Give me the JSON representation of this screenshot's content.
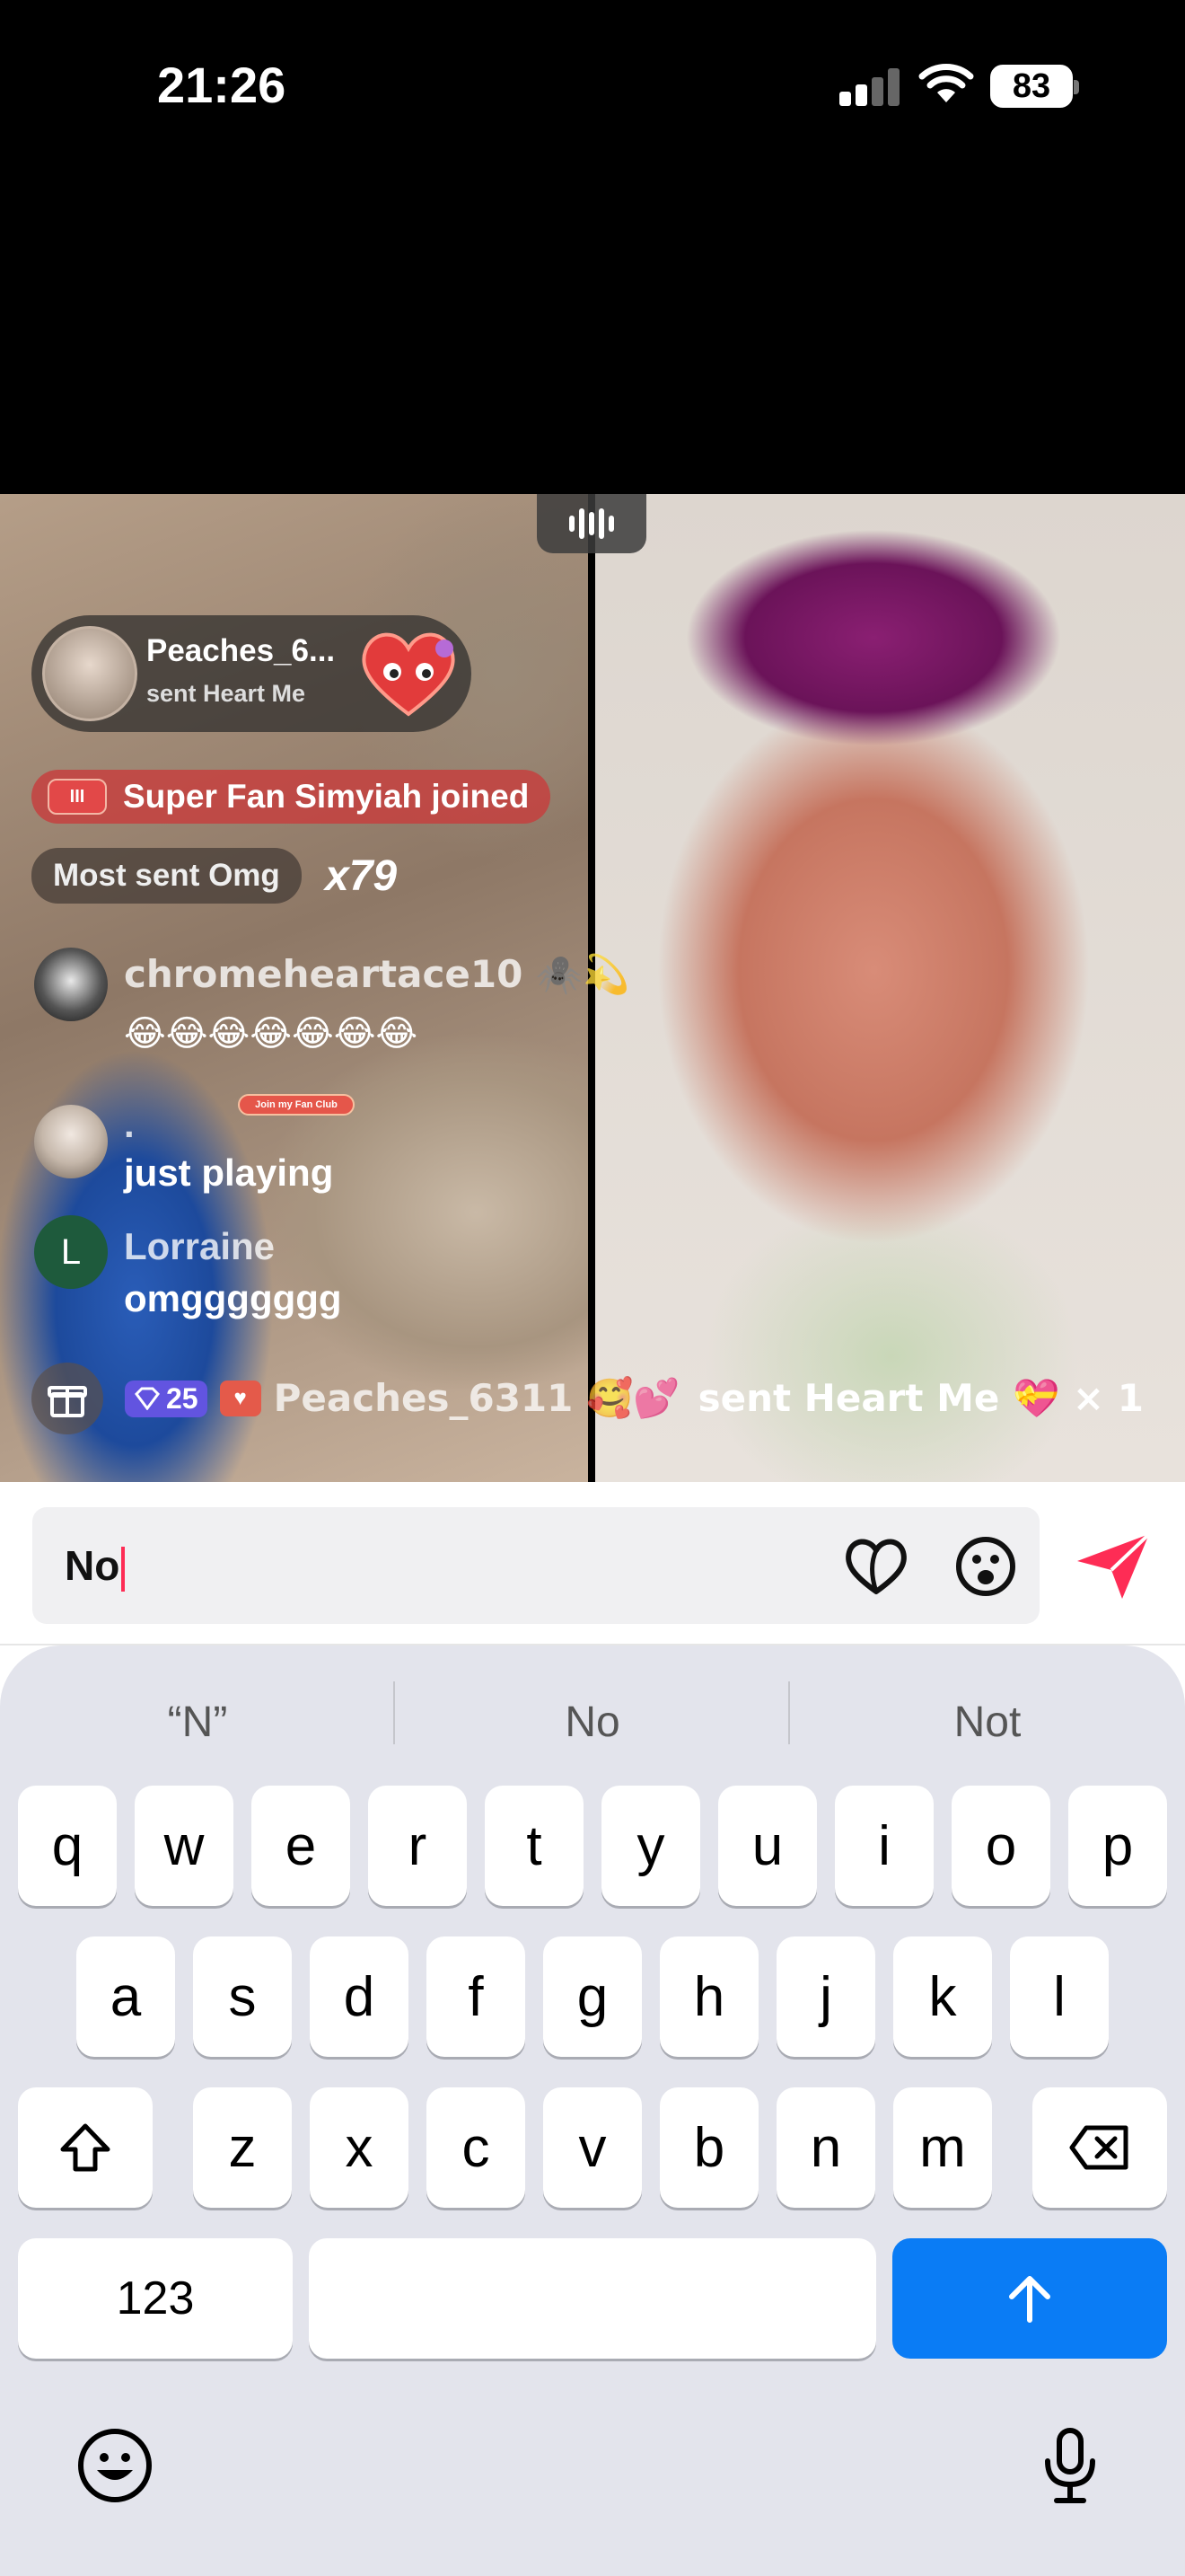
{
  "status_bar": {
    "time": "21:26",
    "battery": "83"
  },
  "live": {
    "gift_banner": {
      "name": "Peaches_6...",
      "sub": "sent Heart Me"
    },
    "superfan": {
      "badge": "III",
      "text": "Super Fan Simyiah joined"
    },
    "most_sent": {
      "text": "Most sent Omg",
      "multiplier": "x79"
    },
    "comments": [
      {
        "name": "chromeheartace10 🕷️💫",
        "text": "😂😂😂😂😂😂😂",
        "sub_badge": "Join my Fan Club"
      },
      {
        "name": ".",
        "text": "just playing"
      },
      {
        "name": "Lorraine",
        "text": "omggggggg",
        "avatar_letter": "L"
      }
    ],
    "gift_line": {
      "diamonds": "25",
      "sender": "Peaches_6311 🥰💕",
      "text": "sent Heart Me 💝 × 1"
    }
  },
  "input": {
    "value": "No"
  },
  "keyboard": {
    "suggestions": [
      "“N”",
      "No",
      "Not"
    ],
    "rows": [
      [
        "q",
        "w",
        "e",
        "r",
        "t",
        "y",
        "u",
        "i",
        "o",
        "p"
      ],
      [
        "a",
        "s",
        "d",
        "f",
        "g",
        "h",
        "j",
        "k",
        "l"
      ],
      [
        "z",
        "x",
        "c",
        "v",
        "b",
        "n",
        "m"
      ]
    ],
    "numbers_key": "123"
  },
  "colors": {
    "accent": "#fe2c55",
    "return_key": "#0a7cf5",
    "keyboard_bg": "#e3e4ec"
  }
}
